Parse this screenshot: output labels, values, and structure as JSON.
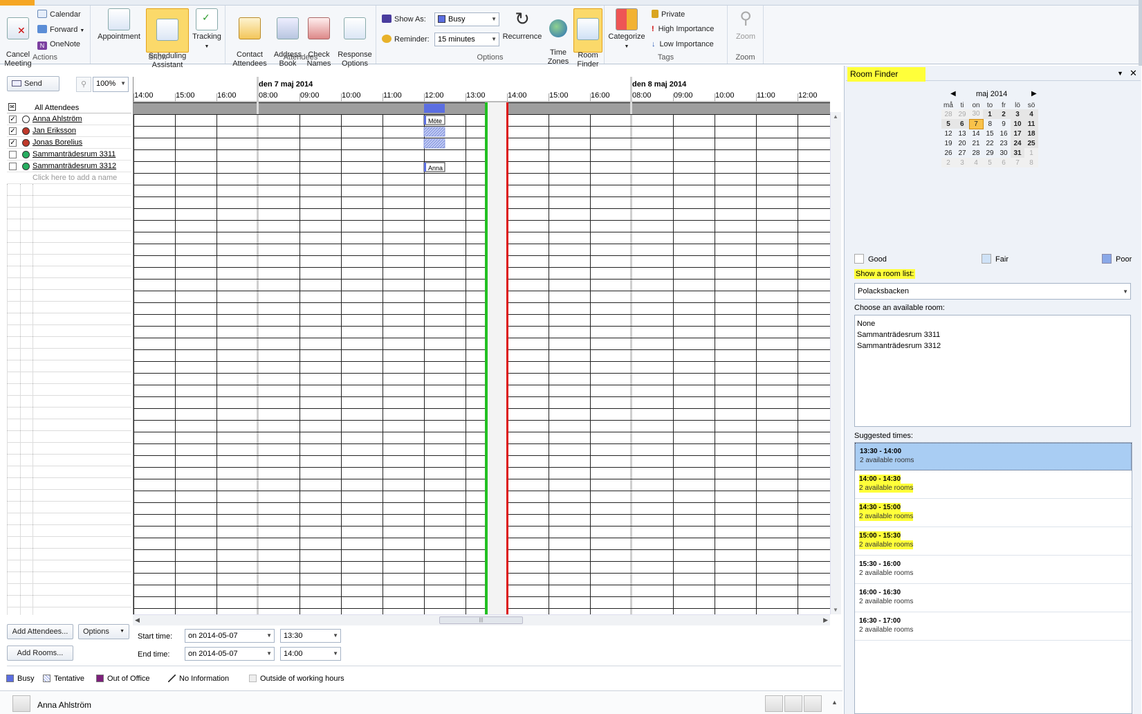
{
  "ribbon": {
    "groups": {
      "actions": "Actions",
      "show": "Show",
      "attendees": "Attendees",
      "options": "Options",
      "tags": "Tags",
      "zoom": "Zoom"
    },
    "cancel_meeting": "Cancel\nMeeting",
    "calendar": "Calendar",
    "forward": "Forward",
    "onenote": "OneNote",
    "appointment": "Appointment",
    "scheduling_assistant": "Scheduling\nAssistant",
    "tracking": "Tracking",
    "contact_attendees": "Contact\nAttendees",
    "address_book": "Address\nBook",
    "check_names": "Check\nNames",
    "response_options": "Response\nOptions",
    "show_as_label": "Show As:",
    "show_as_value": "Busy",
    "reminder_label": "Reminder:",
    "reminder_value": "15 minutes",
    "recurrence": "Recurrence",
    "time_zones": "Time\nZones",
    "room_finder": "Room\nFinder",
    "categorize": "Categorize",
    "private": "Private",
    "high_importance": "High Importance",
    "low_importance": "Low Importance",
    "zoom": "Zoom"
  },
  "toolbar": {
    "send": "Send",
    "zoom_percent": "100%"
  },
  "grid": {
    "day1": "den 7 maj 2014",
    "day2": "den 8 maj 2014",
    "times_prev": [
      "14:00",
      "15:00",
      "16:00"
    ],
    "times_day1": [
      "08:00",
      "09:00",
      "10:00",
      "11:00",
      "12:00",
      "13:00",
      "14:00",
      "15:00",
      "16:00"
    ],
    "times_day2": [
      "08:00",
      "09:00",
      "10:00",
      "11:00",
      "12:00"
    ],
    "event_mote": "Möte",
    "event_anna": "Anna"
  },
  "attendees": {
    "header": "All Attendees",
    "rows": [
      {
        "name": "Anna Ahlström",
        "checked": true,
        "color": "#ffffff"
      },
      {
        "name": "Jan Eriksson",
        "checked": true,
        "color": "#c0392b"
      },
      {
        "name": "Jonas Borelius",
        "checked": true,
        "color": "#c0392b"
      },
      {
        "name": "Sammanträdesrum 3311",
        "checked": false,
        "color": "#27ae60"
      },
      {
        "name": "Sammanträdesrum 3312",
        "checked": false,
        "color": "#27ae60"
      }
    ],
    "add_placeholder": "Click here to add a name"
  },
  "bottom": {
    "add_attendees": "Add Attendees...",
    "options": "Options",
    "add_rooms": "Add Rooms...",
    "start_label": "Start time:",
    "start_date": "on 2014-05-07",
    "start_time": "13:30",
    "end_label": "End time:",
    "end_date": "on 2014-05-07",
    "end_time": "14:00"
  },
  "legend": {
    "busy": "Busy",
    "tentative": "Tentative",
    "out_of_office": "Out of Office",
    "no_information": "No Information",
    "outside_hours": "Outside of working hours"
  },
  "status": {
    "person": "Anna Ahlström"
  },
  "room_finder": {
    "title": "Room Finder",
    "month": "maj 2014",
    "weekdays": [
      "må",
      "ti",
      "on",
      "to",
      "fr",
      "lö",
      "sö"
    ],
    "weeks": [
      [
        "28",
        "29",
        "30",
        "1",
        "2",
        "3",
        "4"
      ],
      [
        "5",
        "6",
        "7",
        "8",
        "9",
        "10",
        "11"
      ],
      [
        "12",
        "13",
        "14",
        "15",
        "16",
        "17",
        "18"
      ],
      [
        "19",
        "20",
        "21",
        "22",
        "23",
        "24",
        "25"
      ],
      [
        "26",
        "27",
        "28",
        "29",
        "30",
        "31",
        "1"
      ],
      [
        "2",
        "3",
        "4",
        "5",
        "6",
        "7",
        "8"
      ]
    ],
    "good": "Good",
    "fair": "Fair",
    "poor": "Poor",
    "show_room_list": "Show a room list:",
    "room_list_value": "Polacksbacken",
    "choose_room": "Choose an available room:",
    "rooms": [
      "None",
      "Sammanträdesrum 3311",
      "Sammanträdesrum 3312"
    ],
    "suggested_label": "Suggested times:",
    "suggestions": [
      {
        "time": "13:30 - 14:00",
        "rooms": "2 available rooms"
      },
      {
        "time": "14:00 - 14:30",
        "rooms": "2 available rooms"
      },
      {
        "time": "14:30 - 15:00",
        "rooms": "2 available rooms"
      },
      {
        "time": "15:00 - 15:30",
        "rooms": "2 available rooms"
      },
      {
        "time": "15:30 - 16:00",
        "rooms": "2 available rooms"
      },
      {
        "time": "16:00 - 16:30",
        "rooms": "2 available rooms"
      },
      {
        "time": "16:30 - 17:00",
        "rooms": "2 available rooms"
      }
    ]
  },
  "colors": {
    "busy": "#5b6ee1",
    "tentative": "#a8b6ee",
    "out_of_office": "#7d1f7b",
    "highlight": "#ffff3a",
    "start_line": "#22c022",
    "end_line": "#dd1111"
  }
}
